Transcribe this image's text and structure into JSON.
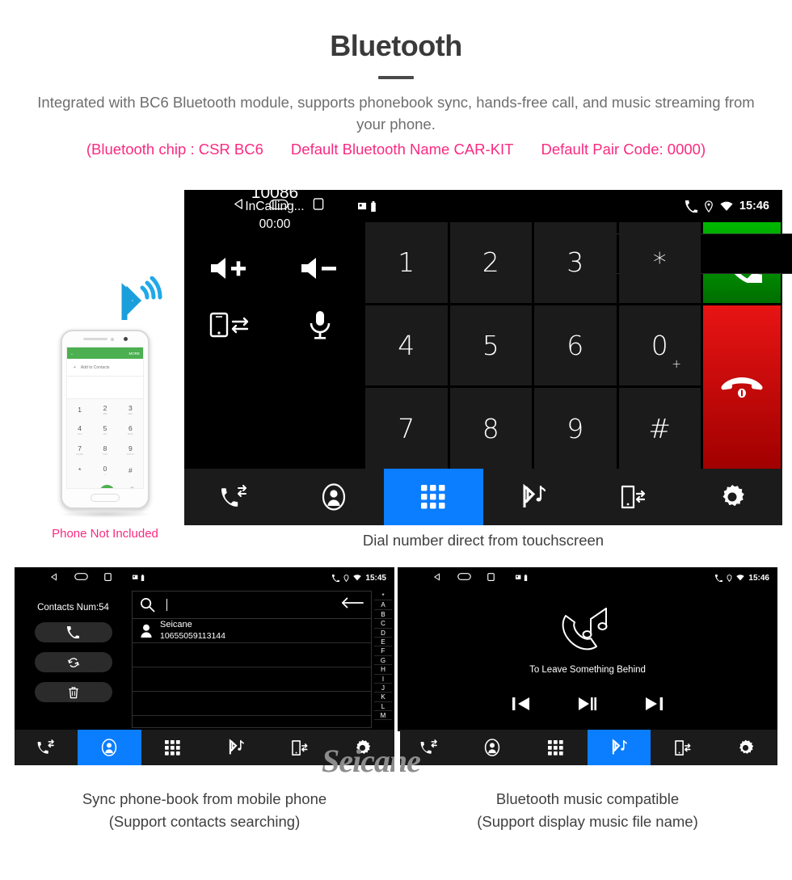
{
  "header": {
    "title": "Bluetooth",
    "subtitle": "Integrated with BC6 Bluetooth module, supports phonebook sync, hands-free call, and music streaming from your phone.",
    "specs": [
      "(Bluetooth chip : CSR BC6",
      "Default Bluetooth Name CAR-KIT",
      "Default Pair Code: 0000)"
    ]
  },
  "colors": {
    "accent_blue": "#0b7dff",
    "pink": "#fa2a80",
    "call_green": "#00b800",
    "end_red": "#e81414",
    "bluetooth_blue": "#1a9fdc"
  },
  "dialer": {
    "statusbar": {
      "time": "15:46",
      "icons": [
        "back-icon",
        "home-icon",
        "recents-icon",
        "sdcard-icon",
        "usb-icon",
        "phone-icon",
        "location-icon",
        "wifi-icon"
      ]
    },
    "dialed_number": "10086",
    "input_value": "",
    "backspace_label": "backspace-icon",
    "call_status": "InCalling...",
    "call_timer": "00:00",
    "controls": [
      {
        "name": "volume-up-icon",
        "label": "Volume Up"
      },
      {
        "name": "volume-down-icon",
        "label": "Volume Down"
      },
      {
        "name": "transfer-audio-icon",
        "label": "Transfer to Phone"
      },
      {
        "name": "microphone-icon",
        "label": "Mute Microphone"
      }
    ],
    "keys": [
      {
        "label": "1",
        "sub": ""
      },
      {
        "label": "2",
        "sub": ""
      },
      {
        "label": "3",
        "sub": ""
      },
      {
        "label": "*",
        "sub": ""
      },
      {
        "label": "4",
        "sub": ""
      },
      {
        "label": "5",
        "sub": ""
      },
      {
        "label": "6",
        "sub": ""
      },
      {
        "label": "0",
        "sub": "+"
      },
      {
        "label": "7",
        "sub": ""
      },
      {
        "label": "8",
        "sub": ""
      },
      {
        "label": "9",
        "sub": ""
      },
      {
        "label": "#",
        "sub": ""
      }
    ],
    "call_button": "call-icon",
    "end_button": "end-call-icon",
    "nav": [
      {
        "name": "call-history",
        "icon": "call-log-icon",
        "active": false
      },
      {
        "name": "contacts",
        "icon": "contact-icon",
        "active": false
      },
      {
        "name": "keypad",
        "icon": "keypad-icon",
        "active": true
      },
      {
        "name": "bluetooth-music",
        "icon": "bluetooth-music-icon",
        "active": false
      },
      {
        "name": "phone-sync",
        "icon": "phone-sync-icon",
        "active": false
      },
      {
        "name": "settings",
        "icon": "gear-icon",
        "active": false
      }
    ],
    "caption": "Dial number direct from touchscreen"
  },
  "phone_mockup": {
    "app_bar_more": "MORE",
    "add_to_contacts": "Add to Contacts",
    "keys": [
      {
        "label": "1",
        "sub": ""
      },
      {
        "label": "2",
        "sub": "ABC"
      },
      {
        "label": "3",
        "sub": "DEF"
      },
      {
        "label": "4",
        "sub": "GHI"
      },
      {
        "label": "5",
        "sub": "JKL"
      },
      {
        "label": "6",
        "sub": "MNO"
      },
      {
        "label": "7",
        "sub": "PQRS"
      },
      {
        "label": "8",
        "sub": "TUV"
      },
      {
        "label": "9",
        "sub": "WXYZ"
      },
      {
        "label": "*",
        "sub": ""
      },
      {
        "label": "0",
        "sub": "+"
      },
      {
        "label": "#",
        "sub": ""
      }
    ],
    "note": "Phone Not Included"
  },
  "contacts_panel": {
    "statusbar_time": "15:45",
    "count_label": "Contacts Num:54",
    "actions": [
      {
        "name": "call-contact",
        "icon": "phone-icon"
      },
      {
        "name": "sync-contacts",
        "icon": "refresh-icon"
      },
      {
        "name": "delete-contacts",
        "icon": "trash-icon"
      }
    ],
    "search_placeholder": "",
    "search_value": "",
    "contacts": [
      {
        "name": "Seicane",
        "number": "10655059113144"
      }
    ],
    "index_letters": [
      "*",
      "A",
      "B",
      "C",
      "D",
      "E",
      "F",
      "G",
      "H",
      "I",
      "J",
      "K",
      "L",
      "M"
    ],
    "nav_active": "contacts",
    "caption_line1": "Sync phone-book from mobile phone",
    "caption_line2": "(Support contacts searching)"
  },
  "music_panel": {
    "statusbar_time": "15:46",
    "track_title": "To Leave Something Behind",
    "controls": [
      {
        "name": "previous-track",
        "icon": "prev-icon"
      },
      {
        "name": "play-pause",
        "icon": "play-pause-icon"
      },
      {
        "name": "next-track",
        "icon": "next-icon"
      }
    ],
    "nav_active": "bluetooth-music",
    "caption_line1": "Bluetooth music compatible",
    "caption_line2": "(Support display music file name)"
  },
  "watermark": "Seicane"
}
